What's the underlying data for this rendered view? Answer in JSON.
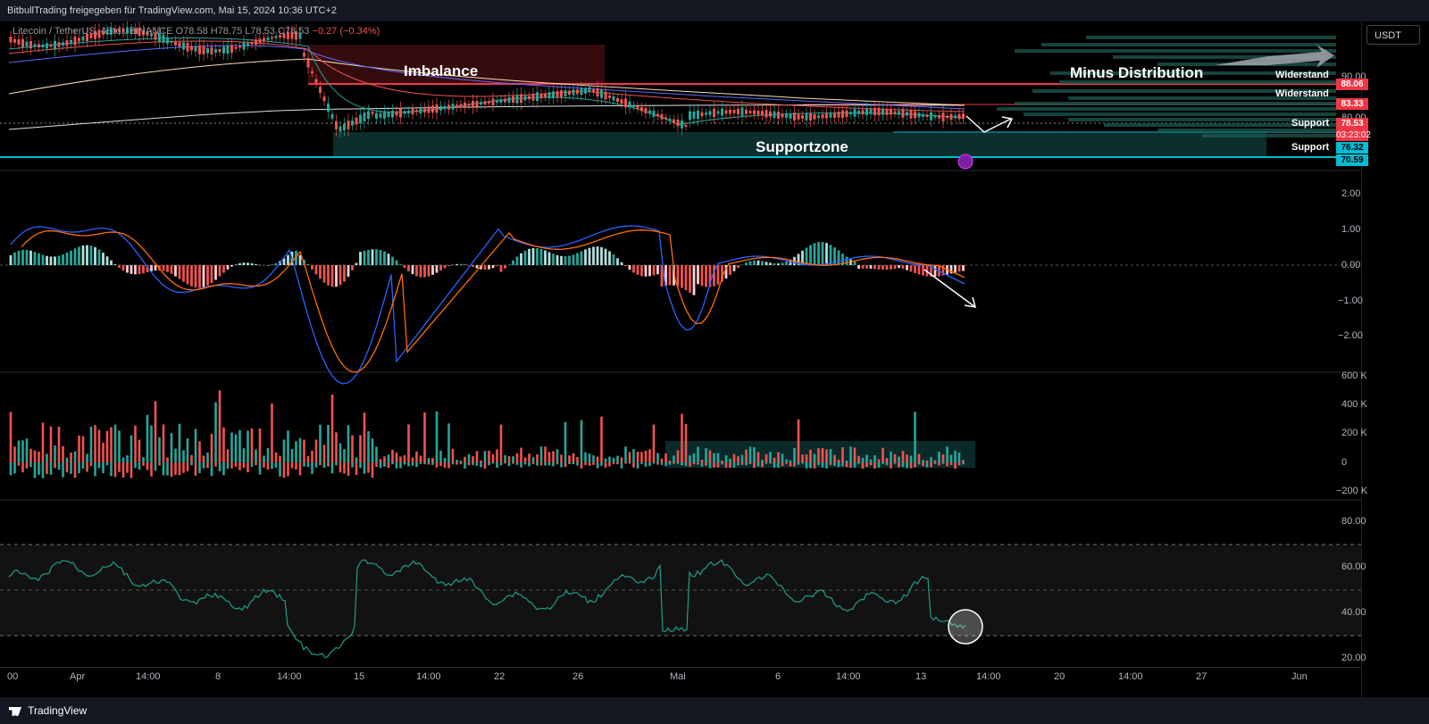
{
  "header": {
    "title": "BitbullTrading freigegeben für TradingView.com, Mai 15, 2024 10:36 UTC+2"
  },
  "legend": {
    "symbol": "Litecoin / TetherUS, 4Std., BINANCE",
    "ohlc": "O78.58 H78.75 L78.53 C78.53",
    "change": "−0.27 (−0.34%)"
  },
  "currency_button": "USDT",
  "annotations": {
    "imbalance": "Imbalance",
    "minus_distribution": "Minus Distribution",
    "supportzone": "Supportzone",
    "widerstand_1": "Widerstand",
    "widerstand_2": "Widerstand",
    "support_1": "Support",
    "support_2": "Support"
  },
  "price_tags": {
    "resistance_high": "88.06",
    "resistance_low": "83.33",
    "last_price": "78.53",
    "countdown": "03:23:02",
    "support_high": "76.32",
    "support_low": "70.59"
  },
  "price_axis": {
    "main": [
      "90.00",
      "80.00"
    ],
    "macd": [
      "2.00",
      "1.00",
      "0.00",
      "−1.00",
      "−2.00"
    ],
    "volume": [
      "600 K",
      "400 K",
      "200 K",
      "0",
      "−200 K"
    ],
    "rsi": [
      "80.00",
      "60.00",
      "40.00",
      "20.00"
    ]
  },
  "time_axis": [
    "00",
    "Apr",
    "14:00",
    "8",
    "14:00",
    "15",
    "14:00",
    "22",
    "26",
    "Mai",
    "6",
    "14:00",
    "13",
    "14:00",
    "20",
    "14:00",
    "27",
    "Jun"
  ],
  "footer": {
    "brand": "TradingView"
  },
  "colors": {
    "background": "#000000",
    "bull": "#26a69a",
    "bear": "#ef5350",
    "imbalance_zone": "#3b0d10",
    "support_zone": "#0b2e2e",
    "resistance_line": "#f23645",
    "support_line": "#00bcd4",
    "macd_line": "#2962ff",
    "signal_line": "#ff6d00",
    "rsi_line": "#1e9e8a"
  }
}
